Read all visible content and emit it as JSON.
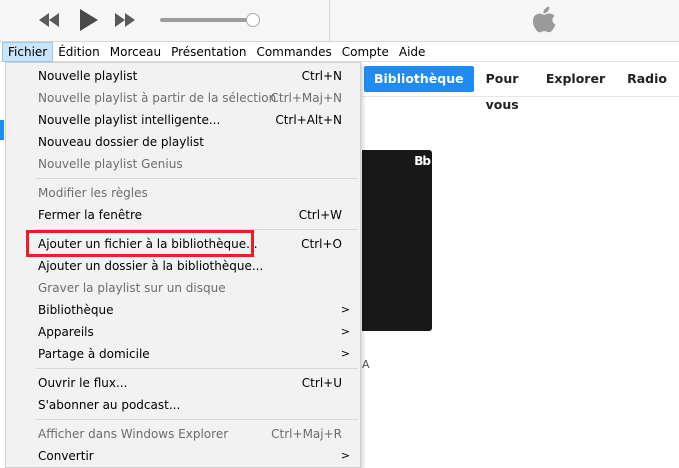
{
  "menubar": {
    "items": [
      "Fichier",
      "Édition",
      "Morceau",
      "Présentation",
      "Commandes",
      "Compte",
      "Aide"
    ]
  },
  "nav": {
    "tabs": [
      "Bibliothèque",
      "Pour vous",
      "Explorer",
      "Radio"
    ],
    "active_tab": "Bibliothèque"
  },
  "player": {
    "volume_level": 0.97,
    "controls": [
      "rewind-icon",
      "play-icon",
      "fast-forward-icon"
    ],
    "logo": "apple-logo-icon"
  },
  "content": {
    "artwork_badge": "Bb",
    "text_fragment": "A"
  },
  "dropdown": {
    "groups": [
      [
        {
          "label": "Nouvelle playlist",
          "shortcut": "Ctrl+N",
          "disabled": false
        },
        {
          "label": "Nouvelle playlist à partir de la sélection",
          "shortcut": "Ctrl+Maj+N",
          "disabled": true
        },
        {
          "label": "Nouvelle playlist intelligente...",
          "shortcut": "Ctrl+Alt+N",
          "disabled": false
        },
        {
          "label": "Nouveau dossier de playlist",
          "shortcut": "",
          "disabled": false
        },
        {
          "label": "Nouvelle playlist Genius",
          "shortcut": "",
          "disabled": true
        }
      ],
      [
        {
          "label": "Modifier les règles",
          "shortcut": "",
          "disabled": true
        },
        {
          "label": "Fermer la fenêtre",
          "shortcut": "Ctrl+W",
          "disabled": false
        }
      ],
      [
        {
          "label": "Ajouter un fichier à la bibliothèque...",
          "shortcut": "Ctrl+O",
          "disabled": false,
          "highlighted": true
        },
        {
          "label": "Ajouter un dossier à la bibliothèque...",
          "shortcut": "",
          "disabled": false
        },
        {
          "label": "Graver la playlist sur un disque",
          "shortcut": "",
          "disabled": true
        },
        {
          "label": "Bibliothèque",
          "shortcut": "",
          "disabled": false,
          "submenu": true
        },
        {
          "label": "Appareils",
          "shortcut": "",
          "disabled": false,
          "submenu": true
        },
        {
          "label": "Partage à domicile",
          "shortcut": "",
          "disabled": false,
          "submenu": true
        }
      ],
      [
        {
          "label": "Ouvrir le flux...",
          "shortcut": "Ctrl+U",
          "disabled": false
        },
        {
          "label": "S'abonner au podcast...",
          "shortcut": "",
          "disabled": false
        }
      ],
      [
        {
          "label": "Afficher dans Windows Explorer",
          "shortcut": "Ctrl+Maj+R",
          "disabled": true
        },
        {
          "label": "Convertir",
          "shortcut": "",
          "disabled": false,
          "submenu": true
        }
      ]
    ],
    "submenu_glyph": ">"
  },
  "colors": {
    "accent": "#1f8cf3",
    "highlight_border": "#ee1c24",
    "menu_active_bg": "#cce4f7",
    "dropdown_bg": "#f2f2f2"
  }
}
